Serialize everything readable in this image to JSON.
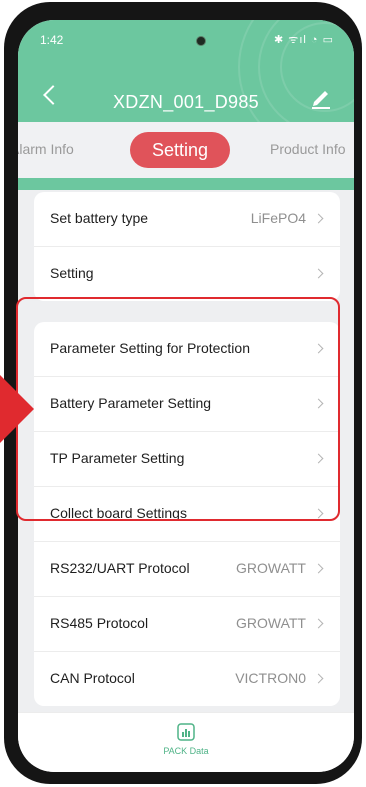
{
  "status_bar": {
    "time": "1:42",
    "icons": "✱ ᯤıl ◔ ▭"
  },
  "nav": {
    "title": "XDZN_001_D985"
  },
  "tabs": {
    "left": "Alarm Info",
    "active": "Setting",
    "right": "Product Info"
  },
  "card1": [
    {
      "label": "Set battery type",
      "value": "LiFePO4"
    },
    {
      "label": "Setting",
      "value": ""
    }
  ],
  "card2": [
    {
      "label": "Parameter Setting for Protection",
      "value": ""
    },
    {
      "label": "Battery Parameter Setting",
      "value": ""
    },
    {
      "label": "TP Parameter Setting",
      "value": ""
    },
    {
      "label": "Collect board Settings",
      "value": ""
    },
    {
      "label": "RS232/UART Protocol",
      "value": "GROWATT"
    },
    {
      "label": "RS485 Protocol",
      "value": "GROWATT"
    },
    {
      "label": "CAN Protocol",
      "value": "VICTRON0"
    }
  ],
  "bottom_nav": {
    "label": "PACK Data"
  },
  "colors": {
    "header": "#6cc79f",
    "active_tab": "#e0535a",
    "highlight": "#e02a2f",
    "accent": "#4fb387"
  }
}
